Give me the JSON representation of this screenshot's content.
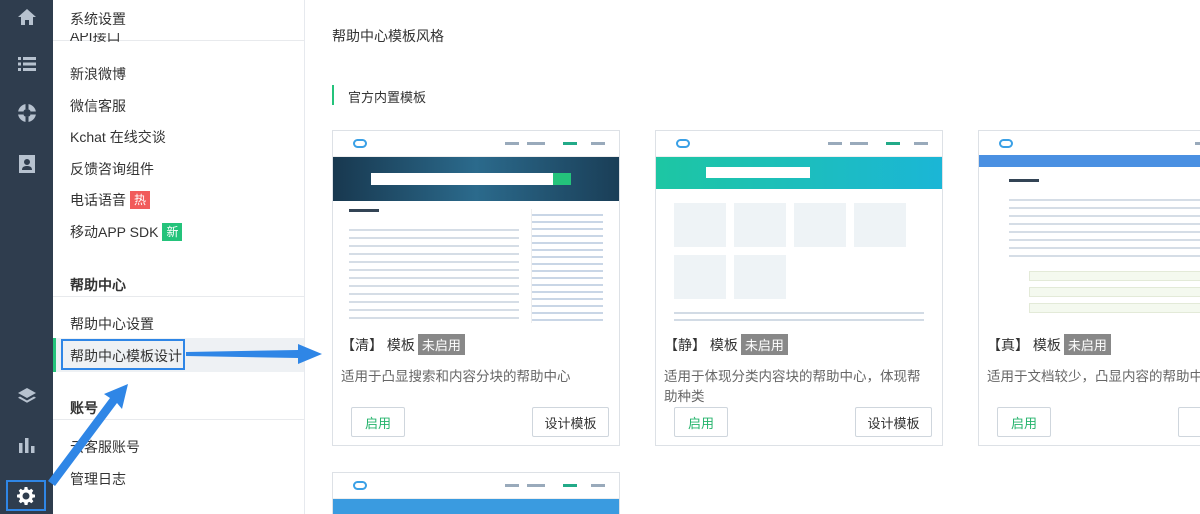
{
  "sidebar": {
    "header": "系统设置",
    "partial_item": "API接口",
    "items_settings": [
      {
        "label": "新浪微博"
      },
      {
        "label": "微信客服"
      },
      {
        "label": "Kchat 在线交谈"
      },
      {
        "label": "反馈咨询组件"
      },
      {
        "label": "电话语音",
        "tag": "热",
        "tag_color": "#f15a5a"
      },
      {
        "label": "移动APP SDK",
        "tag": "新",
        "tag_color": "#24c37b"
      }
    ],
    "help_center_title": "帮助中心",
    "help_center_items": [
      {
        "label": "帮助中心设置"
      },
      {
        "label": "帮助中心模板设计"
      }
    ],
    "account_title": "账号",
    "account_items": [
      {
        "label": "云客服账号"
      },
      {
        "label": "管理日志"
      }
    ]
  },
  "rail": {
    "icons": [
      "home-icon",
      "list-icon",
      "lifebuoy-icon",
      "contact-card-icon",
      "layers-icon",
      "bar-chart-icon",
      "gear-icon"
    ],
    "active": "gear-icon"
  },
  "main": {
    "page_title": "帮助中心模板风格",
    "section_title": "官方内置模板",
    "templates": [
      {
        "name": "【清】 模板",
        "status": "未启用",
        "desc": "适用于凸显搜索和内容分块的帮助中心",
        "enable": "启用",
        "design": "设计模板"
      },
      {
        "name": "【静】 模板",
        "status": "未启用",
        "desc": "适用于体现分类内容块的帮助中心，体现帮助种类",
        "enable": "启用",
        "design": "设计模板"
      },
      {
        "name": "【真】 模板",
        "status": "未启用",
        "desc": "适用于文档较少，凸显内容的帮助中心",
        "enable": "启用",
        "design": "设计模板"
      }
    ]
  },
  "colors": {
    "accent_green": "#24c37b",
    "annotation_blue": "#2f86e6",
    "rail_bg": "#2f3d4e",
    "status_gray": "#888888"
  }
}
